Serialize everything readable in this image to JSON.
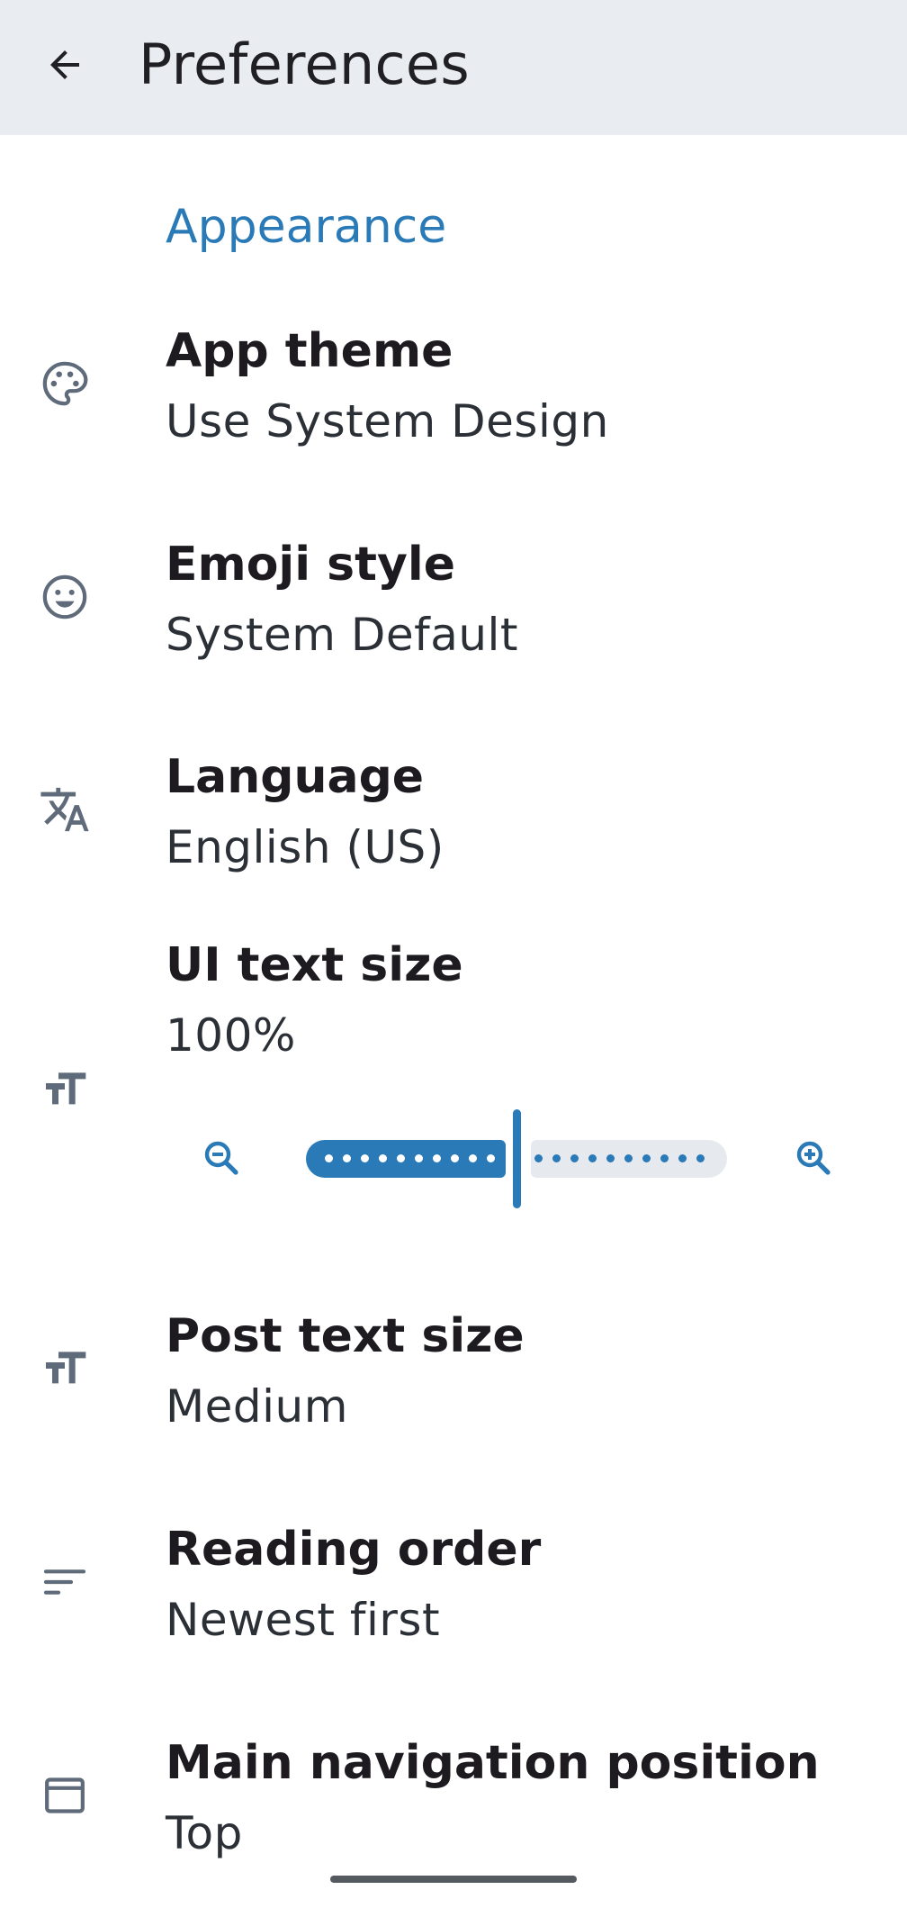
{
  "header": {
    "title": "Preferences",
    "back_icon": "arrow-left-icon"
  },
  "section": {
    "title": "Appearance",
    "accent_color": "#2a7ab8"
  },
  "settings": [
    {
      "icon": "palette-icon",
      "title": "App theme",
      "value": "Use System Design"
    },
    {
      "icon": "emoji-icon",
      "title": "Emoji style",
      "value": "System Default"
    },
    {
      "icon": "translate-icon",
      "title": "Language",
      "value": "English (US)"
    },
    {
      "icon": "text-size-icon",
      "title": "UI text size",
      "value": "100%"
    },
    {
      "icon": "text-size-icon",
      "title": "Post text size",
      "value": "Medium"
    },
    {
      "icon": "sort-icon",
      "title": "Reading order",
      "value": "Newest first"
    },
    {
      "icon": "window-icon",
      "title": "Main navigation position",
      "value": "Top"
    }
  ],
  "ui_text_size_slider": {
    "zoom_out_icon": "zoom-out-icon",
    "zoom_in_icon": "zoom-in-icon",
    "fraction": 0.5
  }
}
